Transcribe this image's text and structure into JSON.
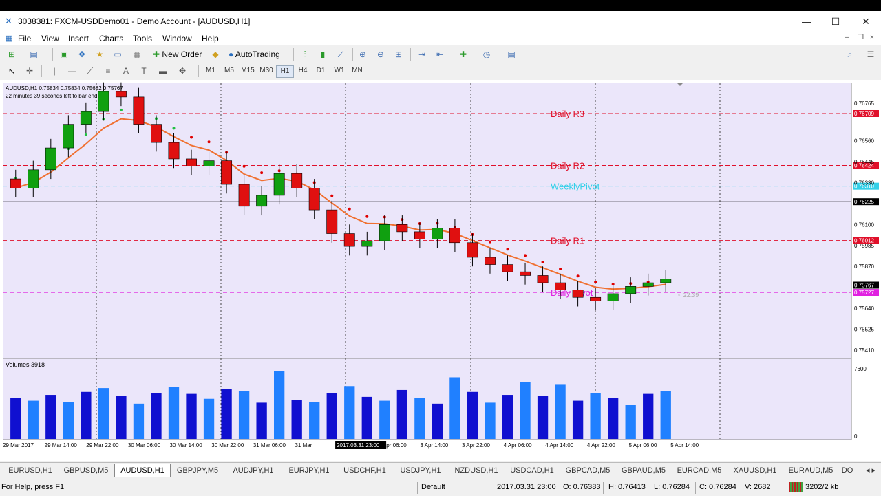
{
  "window": {
    "title": "3038381: FXCM-USDDemo01 - Demo Account - [AUDUSD,H1]",
    "minimize": "—",
    "maximize": "☐",
    "close": "✕"
  },
  "menu": [
    "File",
    "View",
    "Insert",
    "Charts",
    "Tools",
    "Window",
    "Help"
  ],
  "toolbar": {
    "new_order": "New Order",
    "auto_trading": "AutoTrading",
    "timeframes": [
      "M1",
      "M5",
      "M15",
      "M30",
      "H1",
      "H4",
      "D1",
      "W1",
      "MN"
    ],
    "selected_timeframe": "H1"
  },
  "chart": {
    "info_line": "AUDUSD,H1  0.75834 0.75834 0.75682 0.75767",
    "countdown": "22 minutes 39 seconds left to bar end",
    "volume_label": "Volumes 3918",
    "current_marker": "< 22:39",
    "levels": [
      {
        "name": "Daily R3",
        "price": "0.76709",
        "color": "#e0102a",
        "dash": true
      },
      {
        "name": "Daily R2",
        "price": "0.76424",
        "color": "#e0102a",
        "dash": true
      },
      {
        "name": "WeeklyPivot",
        "price": "0.76310",
        "color": "#33d0e8",
        "dash": true
      },
      {
        "name": "",
        "price": "0.76225",
        "color": "#000000",
        "dash": false
      },
      {
        "name": "Daily R1",
        "price": "0.76012",
        "color": "#e0102a",
        "dash": true
      },
      {
        "name": "",
        "price": "0.75767",
        "color": "#000000",
        "dash": false
      },
      {
        "name": "Daily Pivot",
        "price": "0.75727",
        "color": "#e020e0",
        "dash": true
      }
    ],
    "price_ticks": [
      "0.76765",
      "0.76560",
      "0.76445",
      "0.76330",
      "0.76100",
      "0.75985",
      "0.75870",
      "0.75640",
      "0.75525",
      "0.75410"
    ],
    "volume_ticks": [
      "7600",
      "0"
    ],
    "time_ticks": [
      "29 Mar 2017",
      "29 Mar 14:00",
      "29 Mar 22:00",
      "30 Mar 06:00",
      "30 Mar 14:00",
      "30 Mar 22:00",
      "31 Mar 06:00",
      "31 Mar",
      "2017.03.31 23:00",
      "3 Apr 06:00",
      "3 Apr 14:00",
      "3 Apr 22:00",
      "4 Apr 06:00",
      "4 Apr 14:00",
      "4 Apr 22:00",
      "5 Apr 06:00",
      "5 Apr 14:00"
    ],
    "colors": {
      "background": "#ebe6fa",
      "bull": "#10a010",
      "bear": "#e01010",
      "ma_dotted": "#e00000",
      "ma_dotted2": "#20c040",
      "ma_line": "#f07030"
    }
  },
  "chart_data": {
    "type": "candlestick",
    "symbol": "AUDUSD",
    "timeframe": "H1",
    "x_labels": [
      "29 Mar 2017",
      "29 Mar 14:00",
      "29 Mar 22:00",
      "30 Mar 06:00",
      "30 Mar 14:00",
      "30 Mar 22:00",
      "31 Mar 06:00",
      "31 Mar",
      "2017.03.31 23:00",
      "3 Apr 06:00",
      "3 Apr 14:00",
      "3 Apr 22:00",
      "4 Apr 06:00",
      "4 Apr 14:00",
      "4 Apr 22:00",
      "5 Apr 06:00",
      "5 Apr 14:00"
    ],
    "ylim": [
      0.7538,
      0.7686
    ],
    "close": [
      0.763,
      0.764,
      0.7652,
      0.7665,
      0.7672,
      0.7683,
      0.768,
      0.7665,
      0.7655,
      0.7646,
      0.7642,
      0.7645,
      0.7632,
      0.762,
      0.7626,
      0.7638,
      0.763,
      0.7618,
      0.7605,
      0.7598,
      0.7601,
      0.761,
      0.7606,
      0.7602,
      0.7608,
      0.76,
      0.7592,
      0.7588,
      0.7584,
      0.7582,
      0.7578,
      0.7574,
      0.757,
      0.7568,
      0.7572,
      0.7576,
      0.7578,
      0.758
    ],
    "volume": [
      4200,
      3900,
      4500,
      3800,
      4800,
      5200,
      4400,
      3600,
      4700,
      5300,
      4600,
      4100,
      5100,
      4900,
      3700,
      6900,
      4000,
      3800,
      4700,
      5400,
      4300,
      3900,
      5000,
      4200,
      3600,
      6300,
      4800,
      3700,
      4500,
      5800,
      4400,
      5600,
      3900,
      4700,
      4200,
      3500,
      4600,
      4900
    ]
  },
  "tabs": {
    "items": [
      "EURUSD,H1",
      "GBPUSD,M5",
      "AUDUSD,H1",
      "GBPJPY,M5",
      "AUDJPY,H1",
      "EURJPY,H1",
      "USDCHF,H1",
      "USDJPY,H1",
      "NZDUSD,H1",
      "USDCAD,H1",
      "GBPCAD,M5",
      "GBPAUD,M5",
      "EURCAD,M5",
      "XAUUSD,H1",
      "EURAUD,M5",
      "DO"
    ],
    "active": "AUDUSD,H1"
  },
  "status": {
    "help": "For Help, press F1",
    "profile": "Default",
    "datetime": "2017.03.31 23:00",
    "open": "O: 0.76383",
    "high": "H: 0.76413",
    "low": "L: 0.76284",
    "close": "C: 0.76284",
    "volume": "V: 2682",
    "traffic": "3202/2 kb"
  }
}
